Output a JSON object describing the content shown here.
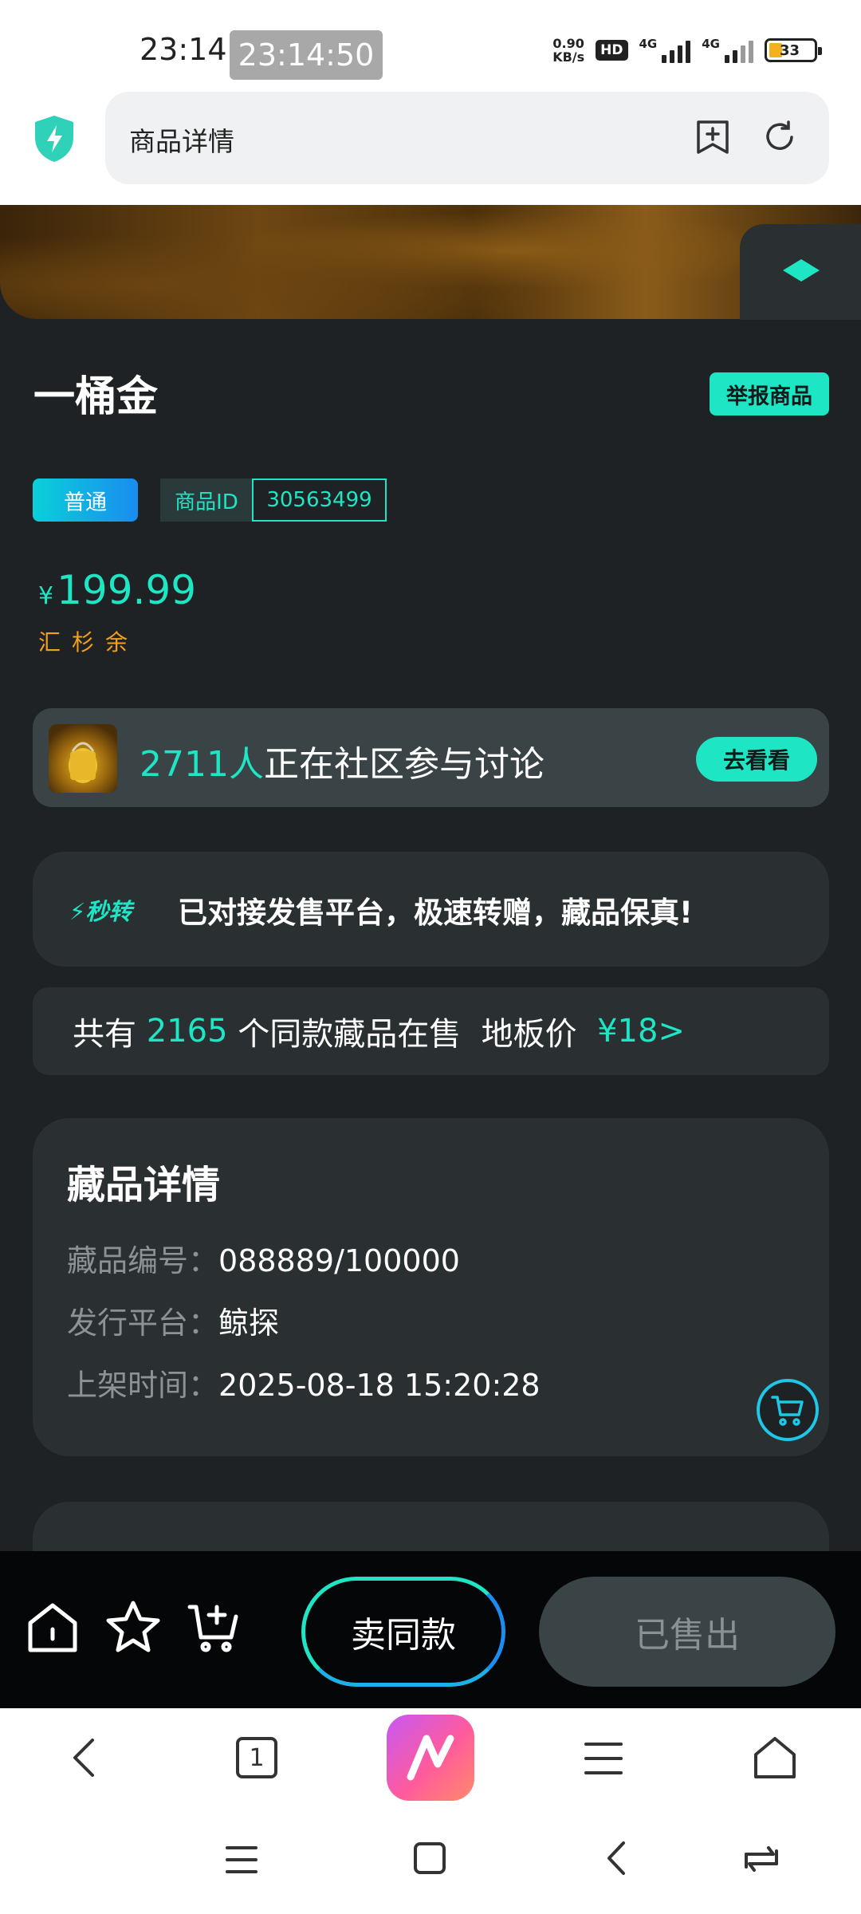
{
  "status_bar": {
    "time": "23:14",
    "recording_time": "23:14:50",
    "net_speed": "0.90",
    "net_speed_unit": "KB/s",
    "hd_badge": "HD",
    "signal_1": "4G",
    "signal_2": "4G",
    "battery": "33"
  },
  "browser": {
    "page_title": "商品详情",
    "add_tab_icon": "add-bookmark-icon",
    "reload_icon": "reload-icon"
  },
  "product": {
    "name": "一桶金",
    "report_label": "举报商品",
    "rarity_tag": "普通",
    "id_label": "商品ID",
    "id_value": "30563499",
    "price_currency": "¥",
    "price_value": "199.99",
    "payment_method": "汇杉余"
  },
  "community": {
    "count": "2711人",
    "text": "正在社区参与讨论",
    "button": "去看看"
  },
  "fast_transfer": {
    "badge": "秒转",
    "text": "已对接发售平台，极速转赠，藏品保真!"
  },
  "market": {
    "prefix": "共有 ",
    "count": "2165",
    "middle": " 个同款藏品在售  地板价  ",
    "floor_price": "¥18>"
  },
  "details": {
    "title": "藏品详情",
    "rows": [
      {
        "label": "藏品编号：",
        "value": "088889/100000"
      },
      {
        "label": "发行平台：",
        "value": "鲸探"
      },
      {
        "label": "上架时间：",
        "value": "2025-08-18 15:20:28"
      }
    ]
  },
  "action_bar": {
    "sell_same": "卖同款",
    "sold_out": "已售出"
  },
  "browser_nav": {
    "tab_count": "1"
  },
  "colors": {
    "accent": "#1ee5c4",
    "background": "#1e2224",
    "card": "#2a2f31",
    "price_orange": "#f2a01e"
  }
}
